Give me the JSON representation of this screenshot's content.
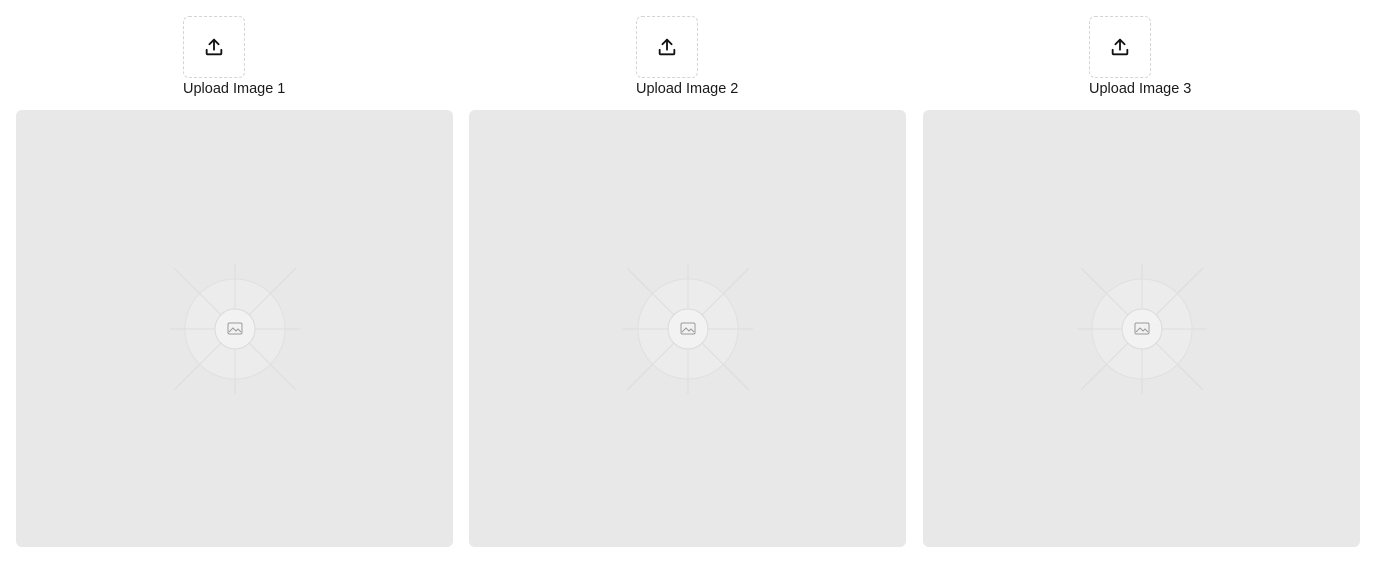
{
  "uploads": [
    {
      "label": "Upload Image 1",
      "icon": "upload-icon"
    },
    {
      "label": "Upload Image 2",
      "icon": "upload-icon"
    },
    {
      "label": "Upload Image 3",
      "icon": "upload-icon"
    }
  ],
  "previews": [
    {
      "icon": "image-placeholder-icon"
    },
    {
      "icon": "image-placeholder-icon"
    },
    {
      "icon": "image-placeholder-icon"
    }
  ],
  "colors": {
    "preview_bg": "#e8e8e8",
    "dashed_border": "#d4d4d4",
    "text": "#1a1a1a"
  }
}
